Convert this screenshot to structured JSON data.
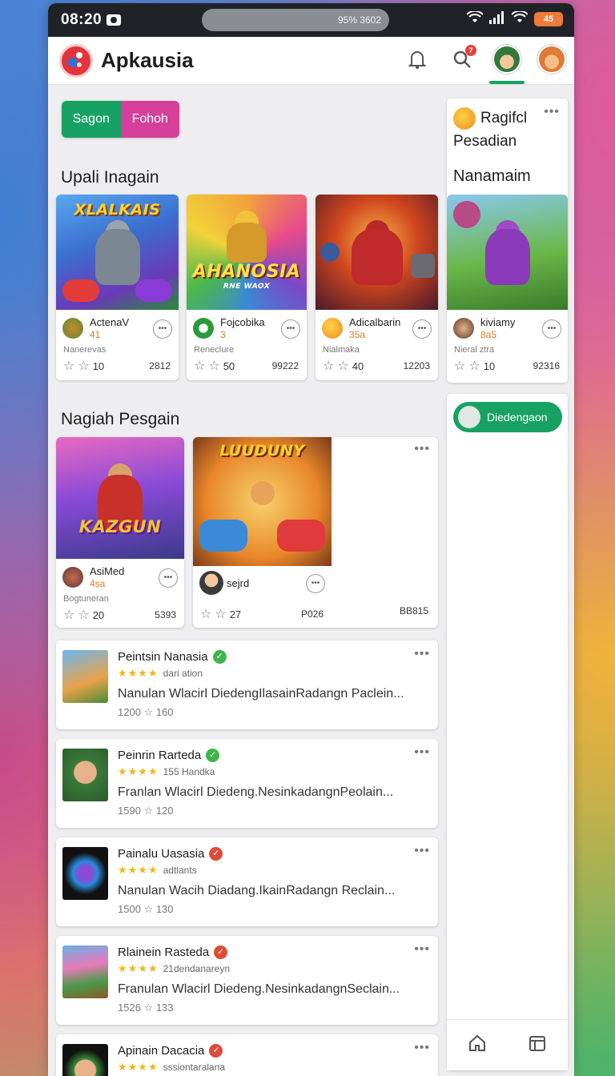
{
  "status": {
    "time": "08:20",
    "pill_text": "95% 3602",
    "battery": "45"
  },
  "app": {
    "title": "Apkausia",
    "notification_badge": "7"
  },
  "toggle": {
    "left": "Sagon",
    "right": "Fohoh"
  },
  "sections": {
    "first": "Upali Inagain",
    "second": "Nagiah Pesgain"
  },
  "featured": [
    {
      "art_title": "XLALKAIS",
      "name": "ActenaV",
      "num": "41",
      "sub": "Nanerevas",
      "rating": "10",
      "count": "2812",
      "accent": "#3a7fd6"
    },
    {
      "art_title": "AHANOSIA",
      "art_sub": "RNE WAOX",
      "name": "Fojcobika",
      "num": "3",
      "sub": "Reneclure",
      "rating": "50",
      "count": "99222",
      "accent": "#f2a23a"
    },
    {
      "art_title": "",
      "name": "Adicalbarin",
      "num": "35a",
      "sub": "Nialmaka",
      "rating": "40",
      "count": "12203",
      "accent": "#c83a2a"
    },
    {
      "art_title": "",
      "name": "kiviamy",
      "num": "8a5",
      "sub": "Nieral ztra",
      "rating": "10",
      "count": "92316",
      "accent": "#7a4ec8"
    }
  ],
  "second_row": [
    {
      "art_title": "KAZGUN",
      "name": "AsiMed",
      "num": "4sa",
      "sub": "Bogtuneran",
      "rating": "20",
      "count": "5393"
    },
    {
      "art_title": "LUUDUNY",
      "name": "sejrd",
      "num": "",
      "sub": "",
      "rating": "27",
      "count": "P026"
    },
    {
      "count": "BB815"
    }
  ],
  "list": [
    {
      "title": "Peintsin Nanasia",
      "verified": "green",
      "rating_text": "dari ation",
      "desc": "Nanulan Wlacirl DiedengIlasainRadangn Paclein...",
      "stats_a": "1200",
      "stats_b": "160"
    },
    {
      "title": "Peinrin Rarteda",
      "verified": "green",
      "rating_text": "155 Handka",
      "desc": "Franlan Wlacirl Diedeng.NesinkadangnPeolain...",
      "stats_a": "1590",
      "stats_b": "120"
    },
    {
      "title": "Painalu Uasasia",
      "verified": "red",
      "rating_text": "adtlants",
      "desc": "Nanulan Wacih Diadang.IkainRadangn Reclain...",
      "stats_a": "1500",
      "stats_b": "130"
    },
    {
      "title": "Rlainein Rasteda",
      "verified": "red",
      "rating_text": "21dendanareyn",
      "desc": "Franulan Wlacirl Diedeng.NesinkadangnSeclain...",
      "stats_a": "1526",
      "stats_b": "133"
    },
    {
      "title": "Apinain Dacacia",
      "verified": "red",
      "rating_text": "sssiontaralana",
      "desc": "",
      "stats_a": "",
      "stats_b": ""
    }
  ],
  "side": {
    "card_title_1": "Ragifcl",
    "card_title_2": "Pesadian",
    "section": "Nanamaim",
    "button": "Diedengaon"
  },
  "colors": {
    "primary_green": "#17a264",
    "accent_pink": "#d63f9a",
    "star": "#f2b418"
  }
}
